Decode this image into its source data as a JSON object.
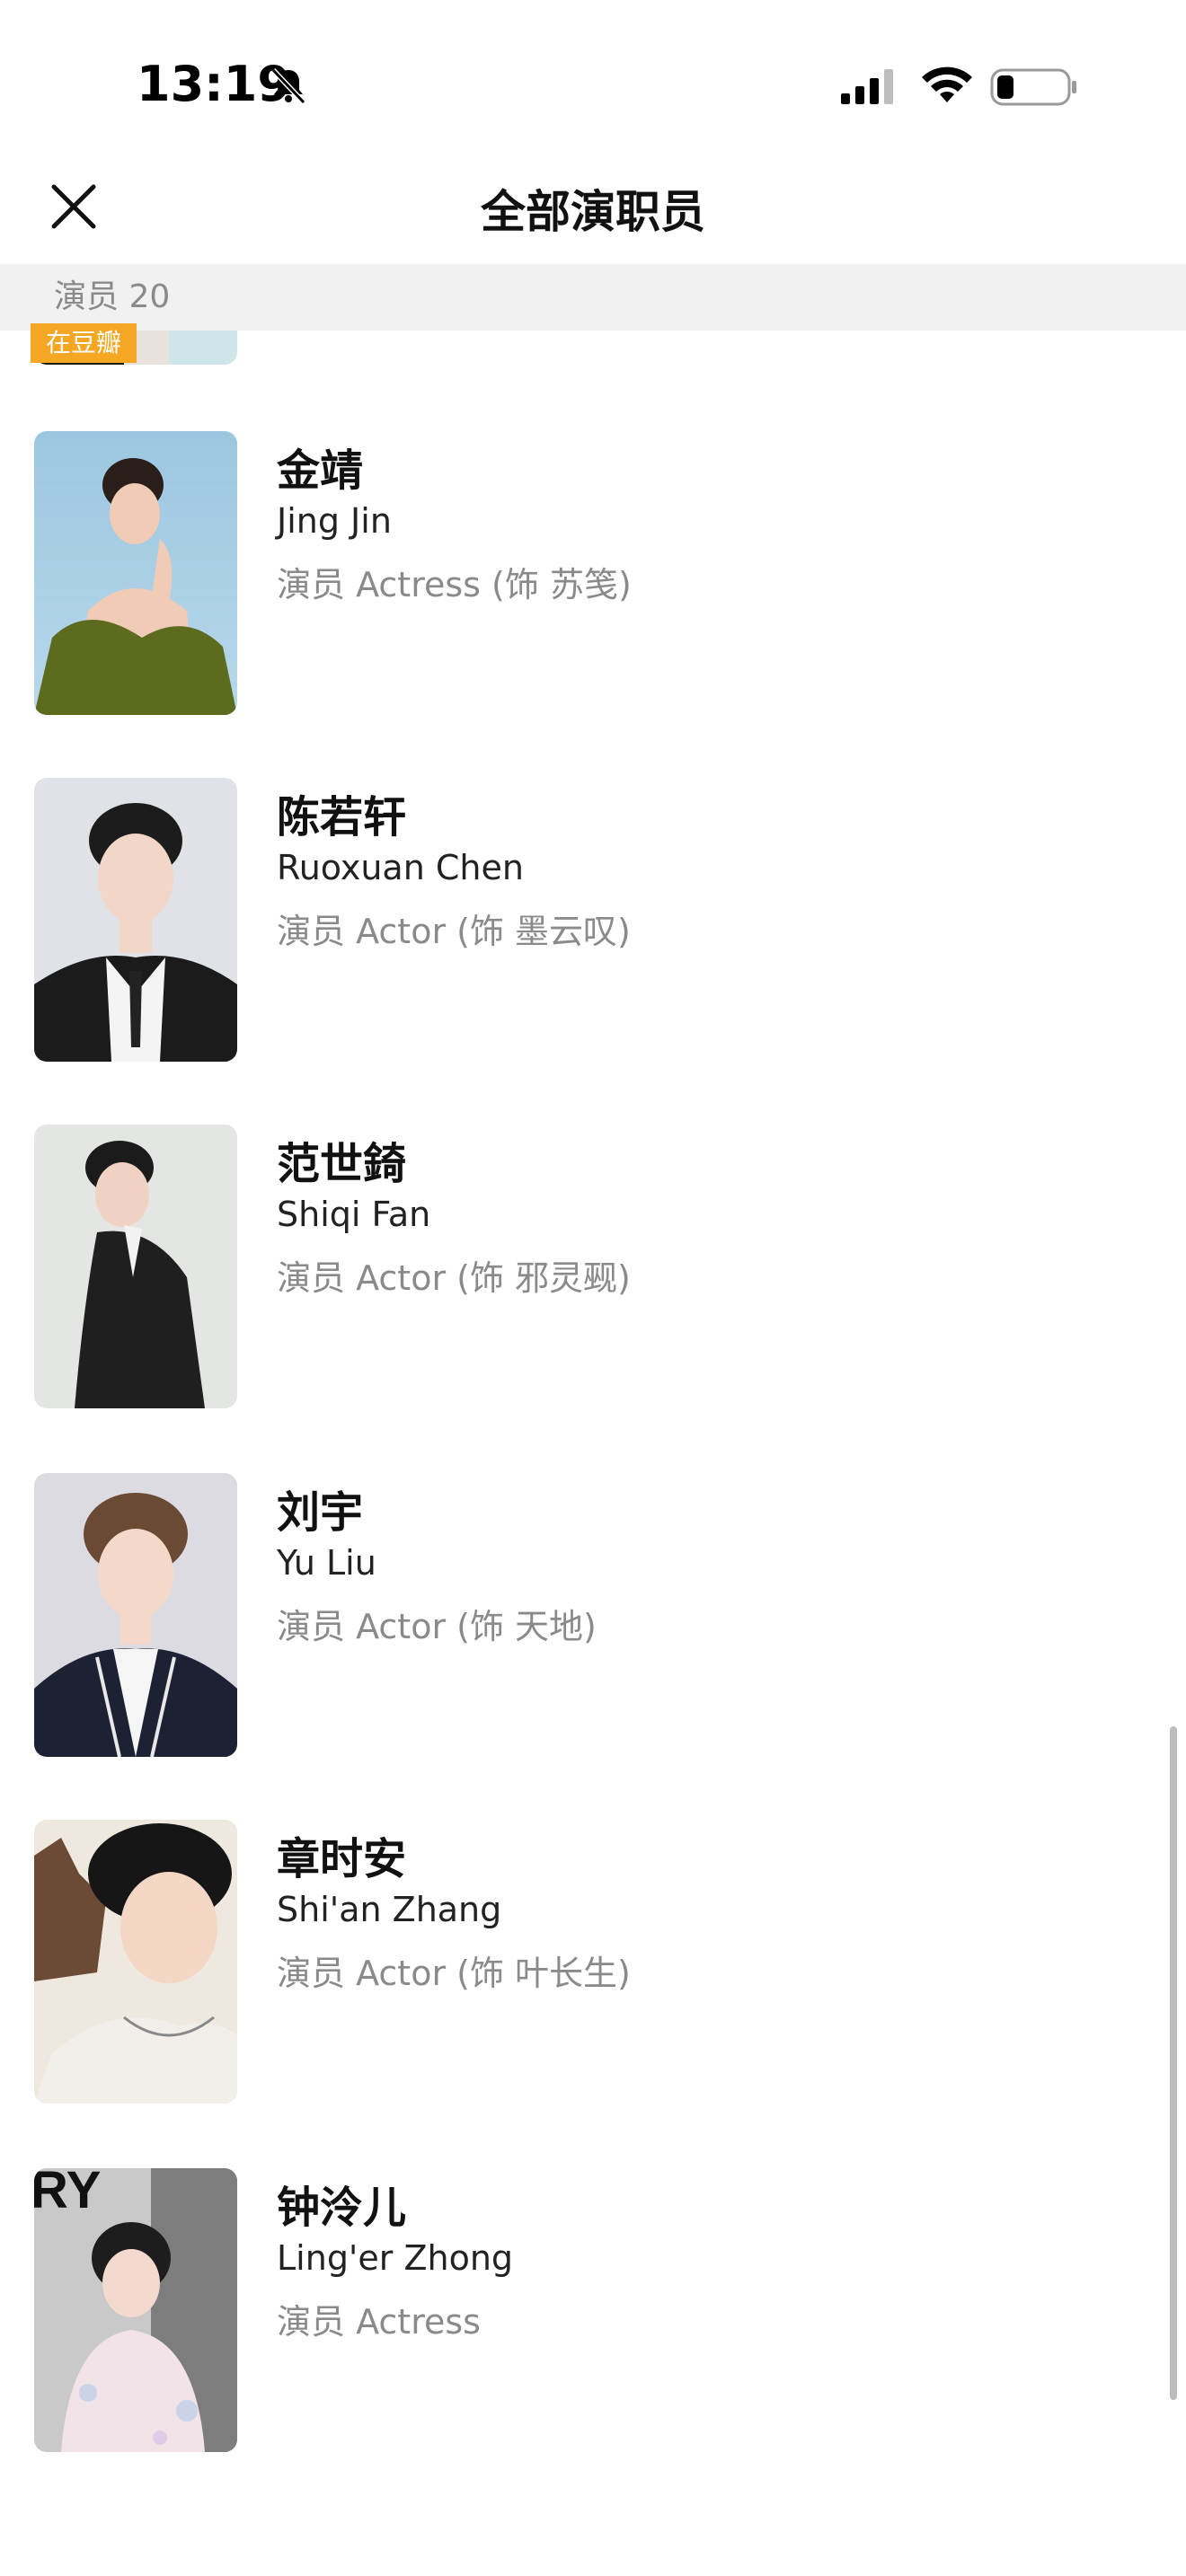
{
  "status_bar": {
    "time": "13:19",
    "icons": [
      "bell-slash-icon",
      "cellular-signal-icon",
      "wifi-icon",
      "battery-icon"
    ]
  },
  "nav": {
    "title": "全部演职员",
    "close_icon": "close-icon"
  },
  "section": {
    "label": "演员 20"
  },
  "partial_item": {
    "badge": "在豆瓣"
  },
  "cast": [
    {
      "name_cn": "金靖",
      "name_en": "Jing Jin",
      "role": "演员 Actress (饰 苏笺)"
    },
    {
      "name_cn": "陈若轩",
      "name_en": "Ruoxuan Chen",
      "role": "演员 Actor (饰 墨云叹)"
    },
    {
      "name_cn": "范世錡",
      "name_en": "Shiqi Fan",
      "role": "演员 Actor (饰 邪灵觋)"
    },
    {
      "name_cn": "刘宇",
      "name_en": "Yu Liu",
      "role": "演员 Actor (饰 天地)"
    },
    {
      "name_cn": "章时安",
      "name_en": "Shi'an Zhang",
      "role": "演员 Actor (饰 叶长生)"
    },
    {
      "name_cn": "钟泠儿",
      "name_en": "Ling'er Zhong",
      "role": "演员 Actress"
    }
  ],
  "last_photo_text": "RY"
}
